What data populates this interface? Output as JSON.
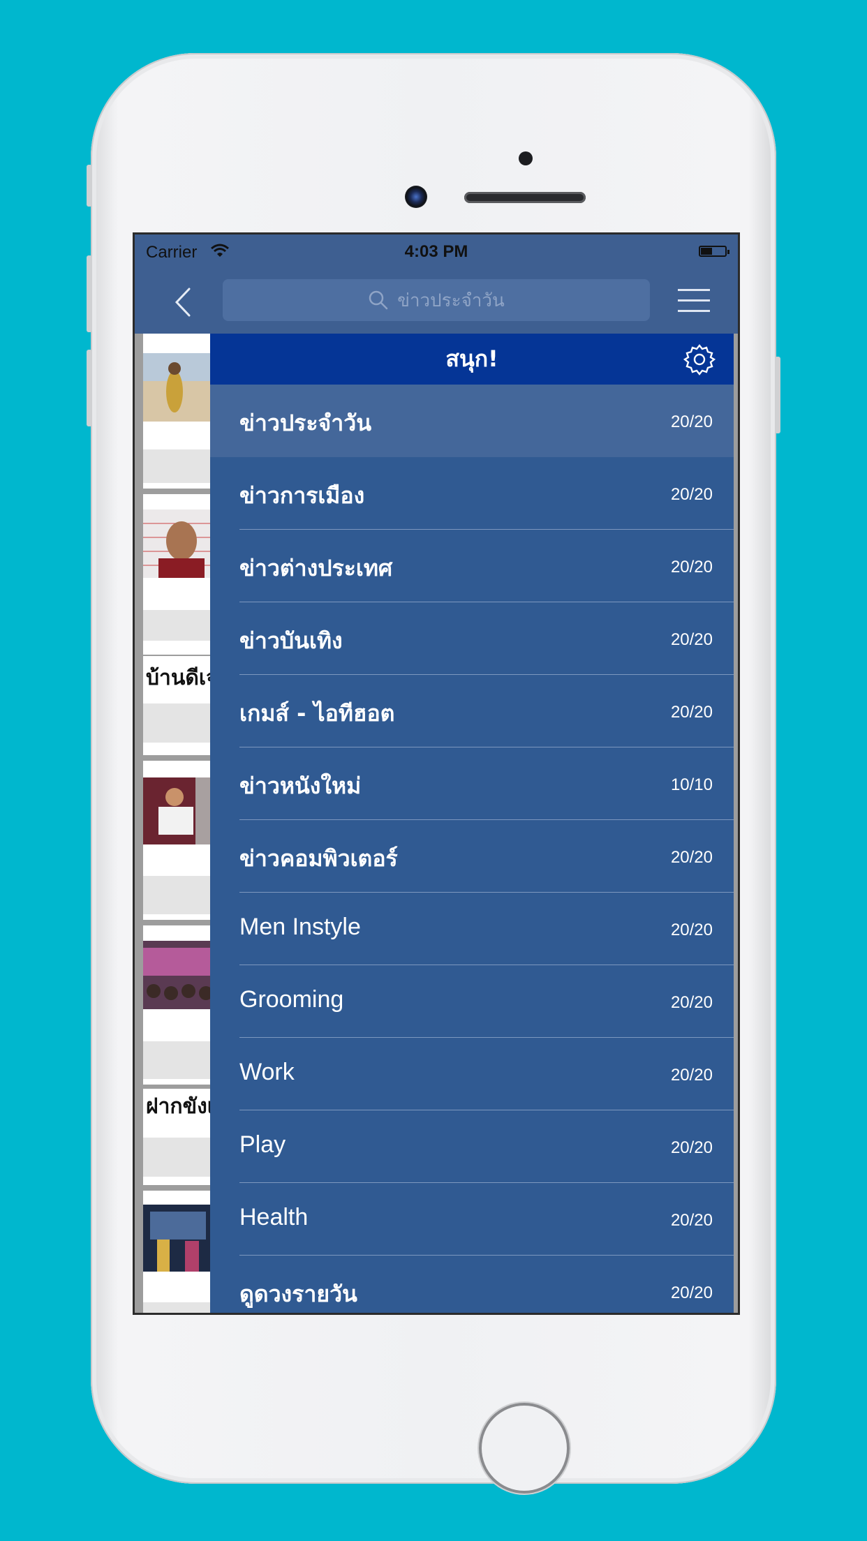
{
  "status_bar": {
    "carrier": "Carrier",
    "time": "4:03 PM"
  },
  "nav": {
    "search_placeholder": "ข่าวประจำวัน"
  },
  "drawer": {
    "title": "สนุก!",
    "categories": [
      {
        "label": "ข่าวประจำวัน",
        "count": "20/20",
        "selected": true
      },
      {
        "label": "ข่าวการเมือง",
        "count": "20/20"
      },
      {
        "label": "ข่าวต่างประเทศ",
        "count": "20/20"
      },
      {
        "label": "ข่าวบันเทิง",
        "count": "20/20"
      },
      {
        "label": "เกมส์ - ไอทีฮอต",
        "count": "20/20"
      },
      {
        "label": "ข่าวหนังใหม่",
        "count": "10/10"
      },
      {
        "label": "ข่าวคอมพิวเตอร์",
        "count": "20/20"
      },
      {
        "label": "Men Instyle",
        "count": "20/20"
      },
      {
        "label": "Grooming",
        "count": "20/20"
      },
      {
        "label": "Work",
        "count": "20/20"
      },
      {
        "label": "Play",
        "count": "20/20"
      },
      {
        "label": "Health",
        "count": "20/20"
      },
      {
        "label": "ดูดวงรายวัน",
        "count": "20/20"
      }
    ]
  },
  "feed": {
    "snippet_1": "บ้านดีเจ",
    "snippet_2": "ฝากขังเ"
  },
  "colors": {
    "background": "#00B7CE",
    "navbar": "#3E5F91",
    "drawer": "#305A92",
    "drawer_header": "#053596",
    "selected_row": "#44679A"
  }
}
